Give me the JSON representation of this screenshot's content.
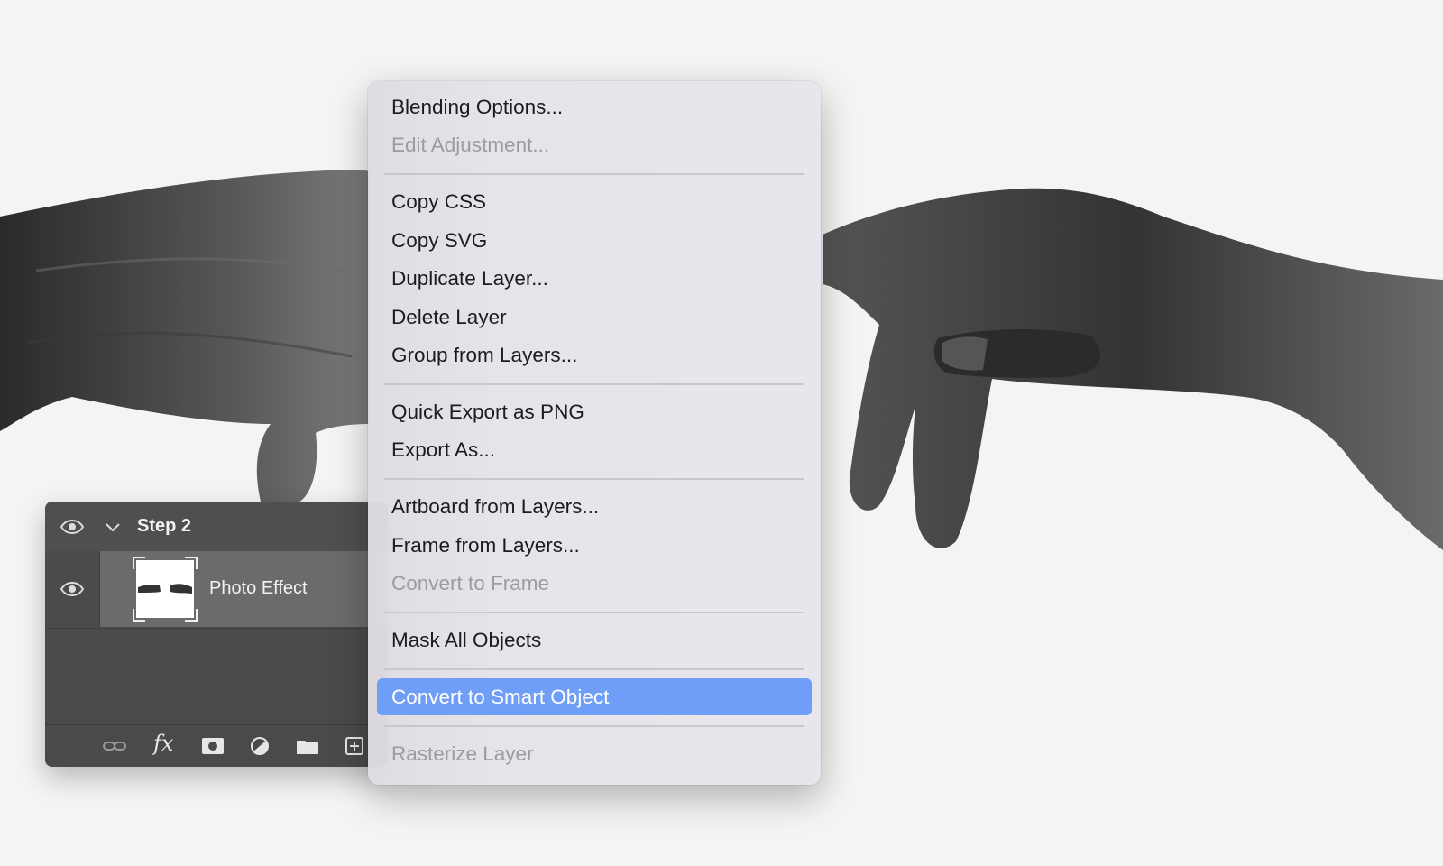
{
  "menu": {
    "groups": [
      [
        {
          "label": "Blending Options...",
          "disabled": false
        },
        {
          "label": "Edit Adjustment...",
          "disabled": true
        }
      ],
      [
        {
          "label": "Copy CSS",
          "disabled": false
        },
        {
          "label": "Copy SVG",
          "disabled": false
        },
        {
          "label": "Duplicate Layer...",
          "disabled": false
        },
        {
          "label": "Delete Layer",
          "disabled": false
        },
        {
          "label": "Group from Layers...",
          "disabled": false
        }
      ],
      [
        {
          "label": "Quick Export as PNG",
          "disabled": false
        },
        {
          "label": "Export As...",
          "disabled": false
        }
      ],
      [
        {
          "label": "Artboard from Layers...",
          "disabled": false
        },
        {
          "label": "Frame from Layers...",
          "disabled": false
        },
        {
          "label": "Convert to Frame",
          "disabled": true
        }
      ],
      [
        {
          "label": "Mask All Objects",
          "disabled": false
        }
      ],
      [
        {
          "label": "Convert to Smart Object",
          "disabled": false,
          "highlighted": true
        }
      ],
      [
        {
          "label": "Rasterize Layer",
          "disabled": true
        }
      ]
    ]
  },
  "layers_panel": {
    "group_name": "Step 2",
    "layer_name": "Photo Effect",
    "toolbar_icons": [
      "link-icon",
      "fx-icon",
      "mask-icon",
      "adjustment-icon",
      "folder-icon",
      "new-layer-icon"
    ]
  },
  "colors": {
    "highlight": "#6e9ef6",
    "panel_bg": "#4a4a4a",
    "selected_row": "#6b6b6b",
    "disabled_text": "#9d9ba0"
  }
}
